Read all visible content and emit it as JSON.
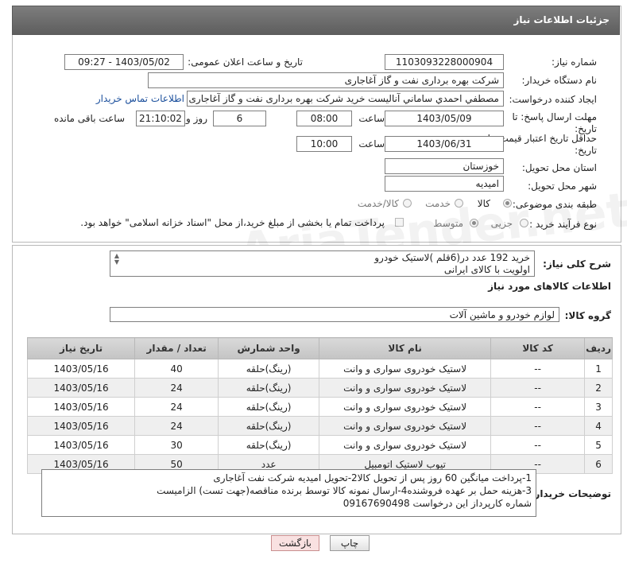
{
  "header": {
    "title": "جزئیات اطلاعات نیاز"
  },
  "fields": {
    "need_number_label": "شماره نیاز:",
    "need_number": "1103093228000904",
    "announce_label": "تاریخ و ساعت اعلان عمومی:",
    "announce_value": "1403/05/02 - 09:27",
    "buyer_org_label": "نام دستگاه خریدار:",
    "buyer_org": "شرکت بهره برداری نفت و گاز آغاجاری",
    "creator_label": "ایجاد کننده درخواست:",
    "creator": "مصطفي احمدي ساماني آنالیست خرید شرکت بهره برداری نفت و گاز آغاجاری",
    "contact_link": "اطلاعات تماس خریدار",
    "reply_deadline_label": "مهلت ارسال پاسخ: تا",
    "reply_deadline_label2": "تاریخ:",
    "reply_date": "1403/05/09",
    "time_label": "ساعت",
    "reply_time": "08:00",
    "days_value": "6",
    "days_label": "روز و",
    "remaining_time": "21:10:02",
    "remaining_label": "ساعت باقی مانده",
    "price_validity_label": "حداقل تاریخ اعتبار قیمت: تا",
    "price_validity_label2": "تاریخ:",
    "price_date": "1403/06/31",
    "price_time": "10:00",
    "province_label": "استان محل تحویل:",
    "province": "خوزستان",
    "city_label": "شهر محل تحویل:",
    "city": "امیدیه",
    "category_label": "طبقه بندی موضوعی:",
    "category_options": [
      "کالا",
      "خدمت",
      "کالا/خدمت"
    ],
    "purchase_type_label": "نوع فرآیند خرید :",
    "purchase_options": [
      "جزیی",
      "متوسط"
    ],
    "treasury_note": "پرداخت تمام یا بخشی از مبلغ خرید،از محل \"اسناد خزانه اسلامی\" خواهد بود."
  },
  "summary": {
    "label": "شرح کلی نیاز:",
    "line1": "خرید 192 عدد در(6قلم )لاستیک خودرو",
    "line2": "اولویت با کالای ایرانی"
  },
  "goods": {
    "section_title": "اطلاعات کالاهای مورد نیاز",
    "group_label": "گروه کالا:",
    "group_value": "لوازم خودرو و ماشین آلات"
  },
  "table": {
    "headers": [
      "ردیف",
      "کد کالا",
      "نام کالا",
      "واحد شمارش",
      "تعداد / مقدار",
      "تاریخ نیاز"
    ],
    "rows": [
      {
        "row": "1",
        "code": "--",
        "name": "لاستیک خودروی سواری و وانت",
        "unit": "(رینگ)حلقه",
        "qty": "40",
        "date": "1403/05/16"
      },
      {
        "row": "2",
        "code": "--",
        "name": "لاستیک خودروی سواری و وانت",
        "unit": "(رینگ)حلقه",
        "qty": "24",
        "date": "1403/05/16"
      },
      {
        "row": "3",
        "code": "--",
        "name": "لاستیک خودروی سواری و وانت",
        "unit": "(رینگ)حلقه",
        "qty": "24",
        "date": "1403/05/16"
      },
      {
        "row": "4",
        "code": "--",
        "name": "لاستیک خودروی سواری و وانت",
        "unit": "(رینگ)حلقه",
        "qty": "24",
        "date": "1403/05/16"
      },
      {
        "row": "5",
        "code": "--",
        "name": "لاستیک خودروی سواری و وانت",
        "unit": "(رینگ)حلقه",
        "qty": "30",
        "date": "1403/05/16"
      },
      {
        "row": "6",
        "code": "--",
        "name": "تیوب لاستیک اتومبیل",
        "unit": "عدد",
        "qty": "50",
        "date": "1403/05/16"
      }
    ]
  },
  "buyer_notes": {
    "label": "توضیحات خریدار:",
    "line1": "1-پرداخت میانگین 60 روز پس از تحویل کالا2-تحویل امیدیه شرکت نفت آغاجاری",
    "line2": "3-هزینه حمل بر عهده فروشنده4-ارسال نمونه کالا توسط برنده مناقصه(جهت تست) الزامیست",
    "line3": "شماره کارپرداز این درخواست 09167690498"
  },
  "buttons": {
    "print": "چاپ",
    "back": "بازگشت"
  }
}
